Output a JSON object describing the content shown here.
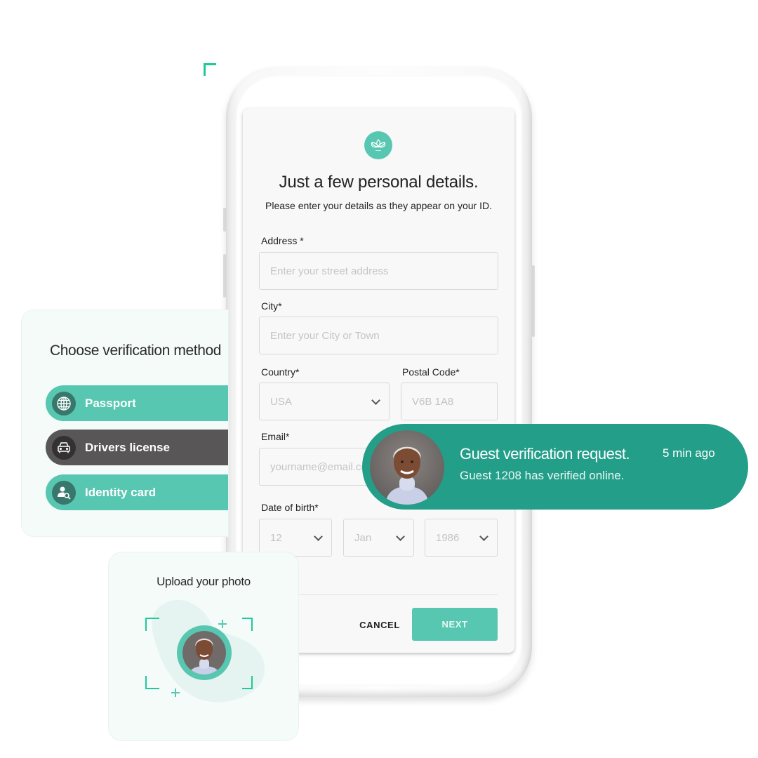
{
  "form": {
    "title": "Just a few personal details.",
    "subtitle": "Please enter your details as they appear on your ID.",
    "logo_icon": "lotus-icon",
    "fields": {
      "address": {
        "label": "Address *",
        "placeholder": "Enter your street address",
        "value": ""
      },
      "city": {
        "label": "City*",
        "placeholder": "Enter your City or Town",
        "value": ""
      },
      "country": {
        "label": "Country*",
        "selected": "USA"
      },
      "postal_code": {
        "label": "Postal Code*",
        "placeholder": "V6B 1A8",
        "value": ""
      },
      "email": {
        "label": "Email*",
        "placeholder": "yourname@email.com",
        "value": ""
      },
      "dob": {
        "label": "Date of birth*",
        "day": "12",
        "month": "Jan",
        "year": "1986"
      }
    },
    "cancel_label": "CANCEL",
    "next_label": "NEXT"
  },
  "verification": {
    "title": "Choose verification method",
    "methods": [
      {
        "label": "Passport",
        "icon": "globe-icon",
        "color": "#58c7b1"
      },
      {
        "label": "Drivers license",
        "icon": "car-icon",
        "color": "#595657"
      },
      {
        "label": "Identity card",
        "icon": "user-search-icon",
        "color": "#58c7b1"
      }
    ]
  },
  "notification": {
    "title": "Guest verification request.",
    "time": "5 min ago",
    "body": "Guest 1208 has verified online."
  },
  "upload": {
    "title": "Upload your photo"
  },
  "colors": {
    "accent": "#58c7b1",
    "notification_bg": "#239e89",
    "dark_item": "#595657",
    "corner_mark": "#1fc99a"
  }
}
